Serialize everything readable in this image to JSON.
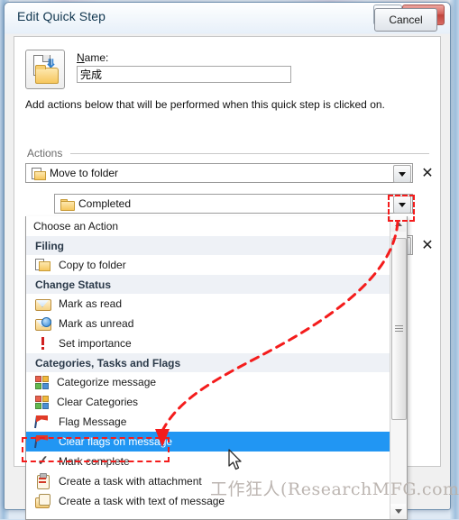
{
  "window": {
    "title": "Edit Quick Step",
    "help_label": "?",
    "close_label": "X"
  },
  "header": {
    "icon": "quick-step-move-to-folder-icon",
    "name_label": "Name:",
    "name_value": "完成",
    "name_placeholder": "",
    "description": "Add actions below that will be performed when this quick step is clicked on."
  },
  "actions": {
    "group_label": "Actions",
    "rows": [
      {
        "icon": "move-to-folder-icon",
        "value": "Move to folder",
        "caret": "▼",
        "remove_label": "✕"
      },
      {
        "icon": "folder-icon",
        "value": "Completed",
        "caret": "▼",
        "remove_label": ""
      },
      {
        "icon": "",
        "value": "Choose an Action",
        "caret": "▼",
        "remove_label": "✕"
      }
    ]
  },
  "dropdown": {
    "open": true,
    "selected": "Clear flags on message",
    "items": [
      {
        "type": "plain",
        "label": "Choose an Action",
        "icon": ""
      },
      {
        "type": "group",
        "label": "Filing",
        "icon": ""
      },
      {
        "type": "item",
        "label": "Copy to folder",
        "icon": "copy-to-folder-icon"
      },
      {
        "type": "group",
        "label": "Change Status",
        "icon": ""
      },
      {
        "type": "item",
        "label": "Mark as read",
        "icon": "mark-as-read-icon"
      },
      {
        "type": "item",
        "label": "Mark as unread",
        "icon": "mark-as-unread-icon"
      },
      {
        "type": "item",
        "label": "Set importance",
        "icon": "set-importance-icon"
      },
      {
        "type": "group",
        "label": "Categories, Tasks and Flags",
        "icon": ""
      },
      {
        "type": "item",
        "label": "Categorize message",
        "icon": "categorize-message-icon"
      },
      {
        "type": "item",
        "label": "Clear Categories",
        "icon": "clear-categories-icon"
      },
      {
        "type": "item",
        "label": "Flag Message",
        "icon": "flag-message-icon"
      },
      {
        "type": "item",
        "label": "Clear flags on message",
        "icon": "clear-flags-icon",
        "selected": true
      },
      {
        "type": "item",
        "label": "Mark complete",
        "icon": "mark-complete-icon"
      },
      {
        "type": "item",
        "label": "Create a task with attachment",
        "icon": "create-task-attachment-icon"
      },
      {
        "type": "item",
        "label": "Create a task with text of message",
        "icon": "create-task-text-icon"
      }
    ],
    "scrollbar": {
      "up": "▲",
      "down": "▼"
    }
  },
  "footer": {
    "cancel_label": "Cancel"
  },
  "annotation": {
    "watermark": "工作狂人(ResearchMFG.com)",
    "highlight_color": "#f41c1c",
    "highlight_targets": [
      "dropdown-caret",
      "clear-flags-on-message-row"
    ]
  },
  "colors": {
    "selection": "#2196f3",
    "group_header_bg": "#eef1f6",
    "annotation_red": "#f41c1c",
    "title_text": "#11364f"
  }
}
